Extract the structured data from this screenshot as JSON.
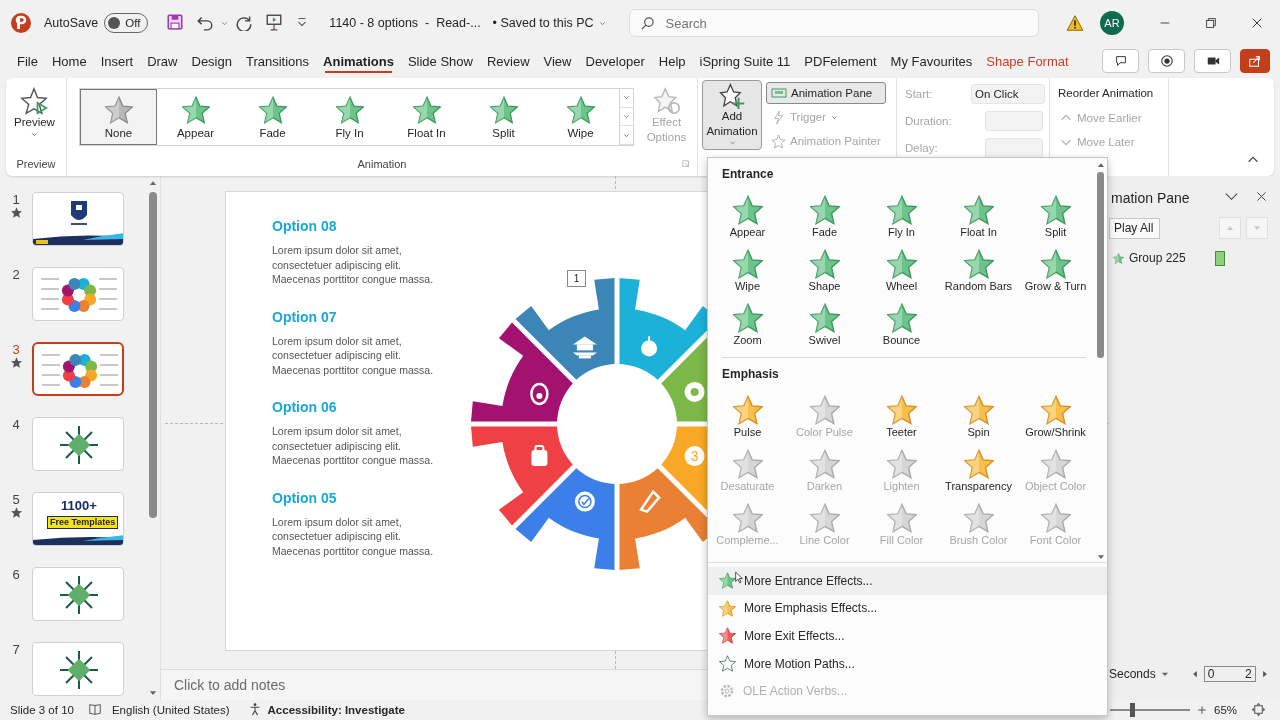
{
  "title_bar": {
    "autosave": {
      "label": "AutoSave",
      "toggle": "Off",
      "on": false
    },
    "document_title": "1140 - 8 options  -  Read-...",
    "save_status": "• Saved to this PC",
    "search": {
      "placeholder": "Search"
    },
    "avatar": "AR"
  },
  "menu_tabs": [
    {
      "label": "File",
      "selected": false,
      "contextual": false
    },
    {
      "label": "Home",
      "selected": false,
      "contextual": false
    },
    {
      "label": "Insert",
      "selected": false,
      "contextual": false
    },
    {
      "label": "Draw",
      "selected": false,
      "contextual": false
    },
    {
      "label": "Design",
      "selected": false,
      "contextual": false
    },
    {
      "label": "Transitions",
      "selected": false,
      "contextual": false
    },
    {
      "label": "Animations",
      "selected": true,
      "contextual": false
    },
    {
      "label": "Slide Show",
      "selected": false,
      "contextual": false
    },
    {
      "label": "Review",
      "selected": false,
      "contextual": false
    },
    {
      "label": "View",
      "selected": false,
      "contextual": false
    },
    {
      "label": "Developer",
      "selected": false,
      "contextual": false
    },
    {
      "label": "Help",
      "selected": false,
      "contextual": false
    },
    {
      "label": "iSpring Suite 11",
      "selected": false,
      "contextual": false
    },
    {
      "label": "PDFelement",
      "selected": false,
      "contextual": false
    },
    {
      "label": "My Favourites",
      "selected": false,
      "contextual": false
    },
    {
      "label": "Shape Format",
      "selected": false,
      "contextual": true
    }
  ],
  "ribbon": {
    "preview": {
      "button": "Preview",
      "group_label": "Preview"
    },
    "animation": {
      "group_label": "Animation",
      "gallery": [
        {
          "label": "None",
          "selected": true,
          "kind": "none"
        },
        {
          "label": "Appear",
          "selected": false,
          "kind": "effect"
        },
        {
          "label": "Fade",
          "selected": false,
          "kind": "effect"
        },
        {
          "label": "Fly In",
          "selected": false,
          "kind": "effect"
        },
        {
          "label": "Float In",
          "selected": false,
          "kind": "effect"
        },
        {
          "label": "Split",
          "selected": false,
          "kind": "effect"
        },
        {
          "label": "Wipe",
          "selected": false,
          "kind": "effect"
        }
      ],
      "effect_options": {
        "label": "Effect Options",
        "disabled": true
      }
    },
    "add_animation": {
      "label": "Add Animation",
      "expanded": true
    },
    "animation_pane": {
      "label": "Animation Pane",
      "selected": true
    },
    "trigger": {
      "label": "Trigger",
      "disabled": true
    },
    "animation_painter": {
      "label": "Animation Painter",
      "disabled": true
    },
    "timing": [
      {
        "label": "Start:",
        "value": "On Click",
        "disabled": true
      },
      {
        "label": "Duration:",
        "disabled": true
      },
      {
        "label": "Delay:",
        "disabled": true
      }
    ],
    "reorder": {
      "title": "Reorder Animation",
      "buttons": [
        {
          "label": "Move Earlier",
          "disabled": true
        },
        {
          "label": "Move Later",
          "disabled": true
        }
      ]
    }
  },
  "slides": [
    {
      "number": "1",
      "animated": true,
      "selected": false,
      "kind": "title"
    },
    {
      "number": "2",
      "animated": false,
      "selected": false,
      "kind": "gear"
    },
    {
      "number": "3",
      "animated": true,
      "selected": true,
      "kind": "gear"
    },
    {
      "number": "4",
      "animated": false,
      "selected": false,
      "kind": "star"
    },
    {
      "number": "5",
      "animated": true,
      "selected": false,
      "kind": "promo",
      "headline": "1100+",
      "tagline": "Free Templates"
    },
    {
      "number": "6",
      "animated": false,
      "selected": false,
      "kind": "star"
    },
    {
      "number": "7",
      "animated": false,
      "selected": false,
      "kind": "star"
    }
  ],
  "slide": {
    "options": [
      {
        "title": "Option 08",
        "body": "Lorem ipsum dolor sit amet, consectetuer adipiscing elit. Maecenas porttitor congue massa."
      },
      {
        "title": "Option 07",
        "body": "Lorem ipsum dolor sit amet, consectetuer adipiscing elit. Maecenas porttitor congue massa."
      },
      {
        "title": "Option 06",
        "body": "Lorem ipsum dolor sit amet, consectetuer adipiscing elit. Maecenas porttitor congue massa."
      },
      {
        "title": "Option 05",
        "body": "Lorem ipsum dolor sit amet, consectetuer adipiscing elit. Maecenas porttitor congue massa."
      }
    ],
    "animation_tag": "1",
    "step_number": "3"
  },
  "notes": {
    "placeholder": "Click to add notes"
  },
  "animation_pane": {
    "title": "mation Pane",
    "play_all": "Play All",
    "items": [
      {
        "label": "Group 225"
      }
    ],
    "timeline": {
      "unit": "Seconds",
      "start": "0",
      "end": "2"
    }
  },
  "add_animation_menu": {
    "sections": [
      {
        "title": "Entrance",
        "kind": "entrance",
        "effects": [
          {
            "label": "Appear",
            "disabled": false
          },
          {
            "label": "Fade",
            "disabled": false
          },
          {
            "label": "Fly In",
            "disabled": false
          },
          {
            "label": "Float In",
            "disabled": false
          },
          {
            "label": "Split",
            "disabled": false
          },
          {
            "label": "Wipe",
            "disabled": false
          },
          {
            "label": "Shape",
            "disabled": false
          },
          {
            "label": "Wheel",
            "disabled": false
          },
          {
            "label": "Random Bars",
            "disabled": false
          },
          {
            "label": "Grow & Turn",
            "disabled": false
          },
          {
            "label": "Zoom",
            "disabled": false
          },
          {
            "label": "Swivel",
            "disabled": false
          },
          {
            "label": "Bounce",
            "disabled": false
          }
        ]
      },
      {
        "title": "Emphasis",
        "kind": "emphasis",
        "effects": [
          {
            "label": "Pulse",
            "disabled": false
          },
          {
            "label": "Color Pulse",
            "disabled": true
          },
          {
            "label": "Teeter",
            "disabled": false
          },
          {
            "label": "Spin",
            "disabled": false
          },
          {
            "label": "Grow/Shrink",
            "disabled": false
          },
          {
            "label": "Desaturate",
            "disabled": true
          },
          {
            "label": "Darken",
            "disabled": true
          },
          {
            "label": "Lighten",
            "disabled": true
          },
          {
            "label": "Transparency",
            "disabled": false
          },
          {
            "label": "Object Color",
            "disabled": true
          },
          {
            "label": "Compleme...",
            "disabled": true
          },
          {
            "label": "Line Color",
            "disabled": true
          },
          {
            "label": "Fill Color",
            "disabled": true
          },
          {
            "label": "Brush Color",
            "disabled": true
          },
          {
            "label": "Font Color",
            "disabled": true
          }
        ]
      }
    ],
    "commands": [
      {
        "label": "More Entrance Effects...",
        "kind": "entrance",
        "highlighted": true,
        "disabled": false
      },
      {
        "label": "More Emphasis Effects...",
        "kind": "emphasis",
        "highlighted": false,
        "disabled": false
      },
      {
        "label": "More Exit Effects...",
        "kind": "exit",
        "highlighted": false,
        "disabled": false
      },
      {
        "label": "More Motion Paths...",
        "kind": "motion",
        "highlighted": false,
        "disabled": false
      },
      {
        "label": "OLE Action Verbs...",
        "kind": "ole",
        "highlighted": false,
        "disabled": true
      }
    ]
  },
  "status_bar": {
    "slide_position": "Slide 3 of 10",
    "language": "English (United States)",
    "accessibility": "Accessibility: Investigate",
    "zoom": {
      "level": 0.27,
      "reading": "65%"
    }
  }
}
